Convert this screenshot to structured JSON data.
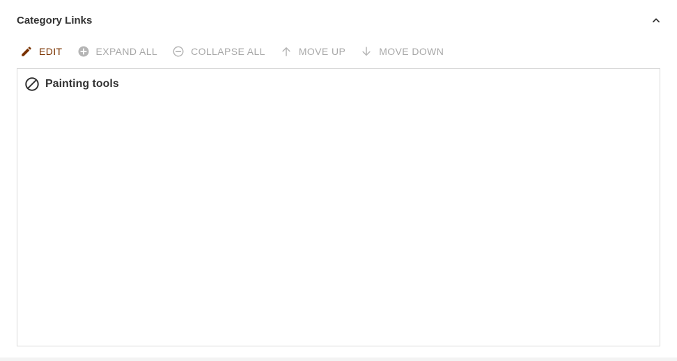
{
  "section": {
    "title": "Category Links",
    "collapse_icon": "chevron-up-icon"
  },
  "toolbar": {
    "edit": {
      "label": "EDIT",
      "icon": "pencil-icon",
      "enabled": true
    },
    "expand_all": {
      "label": "EXPAND ALL",
      "icon": "plus-circle-icon",
      "enabled": false
    },
    "collapse_all": {
      "label": "COLLAPSE ALL",
      "icon": "minus-circle-icon",
      "enabled": false
    },
    "move_up": {
      "label": "MOVE UP",
      "icon": "arrow-up-icon",
      "enabled": false
    },
    "move_down": {
      "label": "MOVE DOWN",
      "icon": "arrow-down-icon",
      "enabled": false
    }
  },
  "tree": {
    "items": [
      {
        "label": "Painting tools",
        "icon": "block-icon"
      }
    ]
  },
  "colors": {
    "accent": "#7a3300",
    "disabled": "#a8a8a8",
    "text": "#333333",
    "border": "#d9d9d9"
  }
}
